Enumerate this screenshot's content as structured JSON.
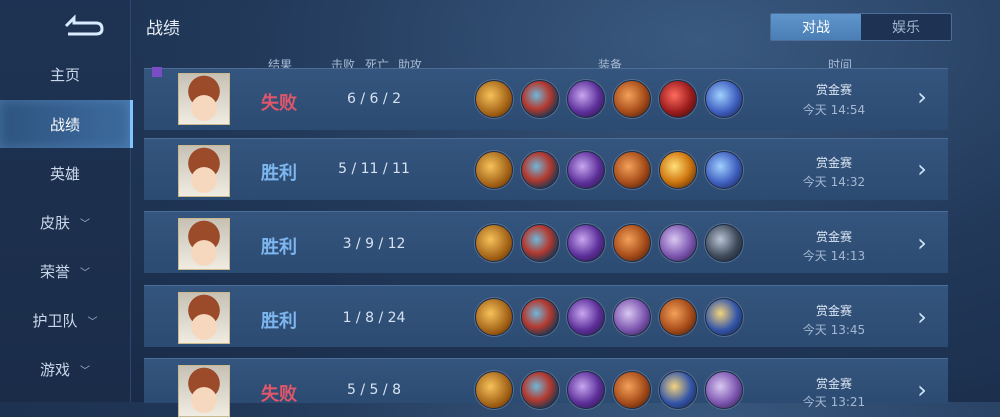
{
  "sidebar": {
    "items": [
      {
        "label": "主页",
        "chevron": false,
        "active": false
      },
      {
        "label": "战绩",
        "chevron": false,
        "active": true
      },
      {
        "label": "英雄",
        "chevron": false,
        "active": false
      },
      {
        "label": "皮肤",
        "chevron": true,
        "active": false
      },
      {
        "label": "荣誉",
        "chevron": true,
        "active": false
      },
      {
        "label": "护卫队",
        "chevron": true,
        "active": false
      },
      {
        "label": "游戏",
        "chevron": true,
        "active": false
      }
    ]
  },
  "header": {
    "title": "战绩",
    "tabs": [
      {
        "label": "对战",
        "active": true
      },
      {
        "label": "娱乐",
        "active": false
      }
    ]
  },
  "columns": {
    "result": "结果",
    "kills": "击败",
    "deaths": "死亡",
    "assists": "助攻",
    "equipment": "装备",
    "time": "时间"
  },
  "matches": [
    {
      "result": "失败",
      "outcome": "lose",
      "kda": "6 / 6 / 2",
      "mode": "赏金赛",
      "time": "今天 14:54",
      "items": [
        "gold-staff-icon",
        "red-boots-icon",
        "purple-axe-icon",
        "orange-blade-icon",
        "red-helmet-icon",
        "blue-spear-icon"
      ]
    },
    {
      "result": "胜利",
      "outcome": "win",
      "kda": "5 / 11 / 11",
      "mode": "赏金赛",
      "time": "今天 14:32",
      "items": [
        "gold-staff-icon",
        "red-boots-icon",
        "purple-axe-icon",
        "orange-blade-icon",
        "fire-wing-icon",
        "blue-spear-icon"
      ]
    },
    {
      "result": "胜利",
      "outcome": "win",
      "kda": "3 / 9 / 12",
      "mode": "赏金赛",
      "time": "今天 14:13",
      "items": [
        "gold-staff-icon",
        "red-boots-icon",
        "purple-axe-icon",
        "orange-blade-icon",
        "skull-mask-icon",
        "dark-claw-icon"
      ]
    },
    {
      "result": "胜利",
      "outcome": "win",
      "kda": "1 / 8 / 24",
      "mode": "赏金赛",
      "time": "今天 13:45",
      "items": [
        "gold-staff-icon",
        "red-boots-icon",
        "purple-axe-icon",
        "skull-mask-icon",
        "orange-blade-icon",
        "blue-gold-sword-icon"
      ]
    },
    {
      "result": "失败",
      "outcome": "lose",
      "kda": "5 / 5 / 8",
      "mode": "赏金赛",
      "time": "今天 13:21",
      "items": [
        "gold-staff-icon",
        "red-boots-icon",
        "purple-axe-icon",
        "orange-blade-icon",
        "blue-gold-sword-icon",
        "skull-mask-icon"
      ]
    }
  ]
}
